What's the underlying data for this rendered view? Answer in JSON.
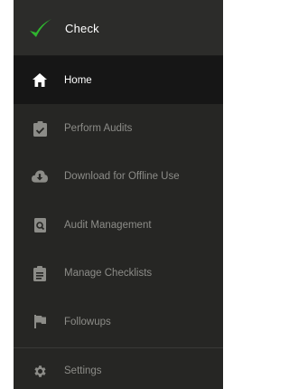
{
  "brand": {
    "name": "Check",
    "accent": "#2fb52f"
  },
  "nav": {
    "items": [
      {
        "label": "Home",
        "icon": "home-icon",
        "active": true
      },
      {
        "label": "Perform Audits",
        "icon": "clipboard-check-icon",
        "active": false
      },
      {
        "label": "Download for Offline Use",
        "icon": "cloud-download-icon",
        "active": false
      },
      {
        "label": "Audit Management",
        "icon": "search-document-icon",
        "active": false
      },
      {
        "label": "Manage Checklists",
        "icon": "clipboard-list-icon",
        "active": false
      },
      {
        "label": "Followups",
        "icon": "flag-icon",
        "active": false
      }
    ]
  },
  "footer": {
    "settings_label": "Settings",
    "settings_icon": "gear-icon"
  },
  "colors": {
    "drawer_bg": "#262624",
    "active_bg": "#161616",
    "inactive_text": "#8c8c88",
    "active_text": "#ffffff"
  }
}
